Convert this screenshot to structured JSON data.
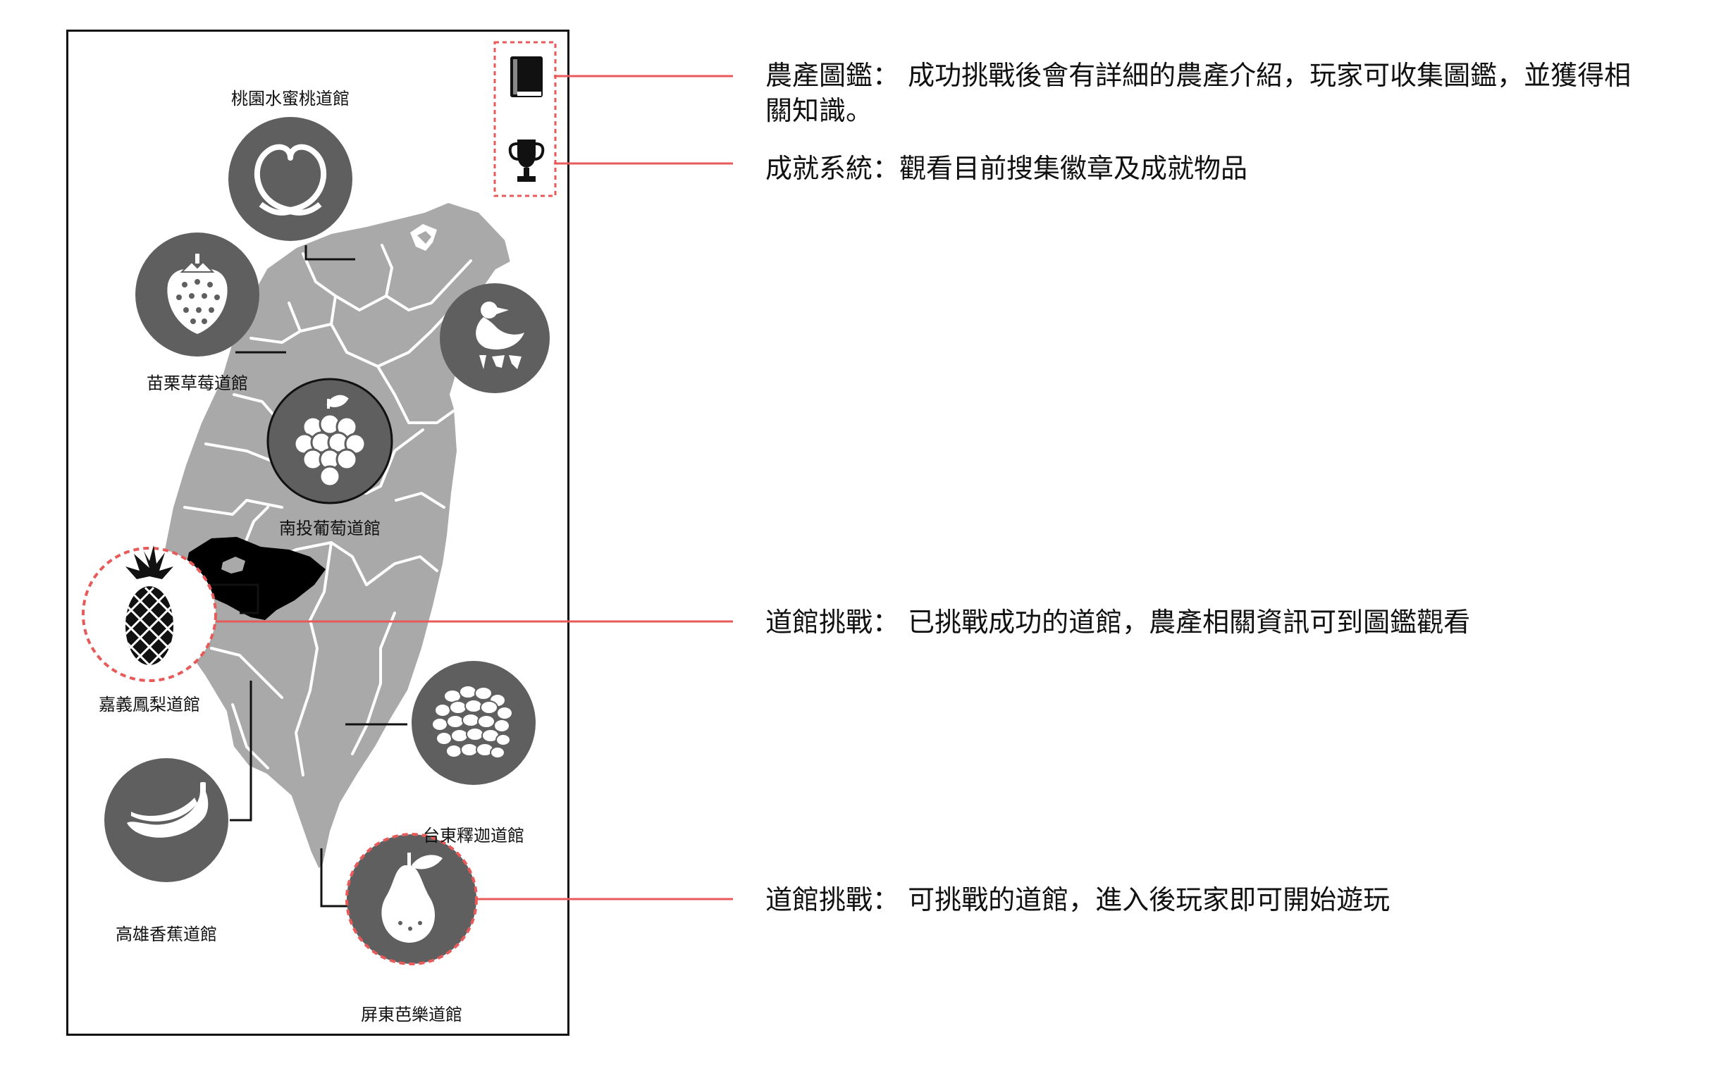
{
  "toolbar": {
    "book_icon": "book-icon",
    "trophy_icon": "trophy-icon"
  },
  "gyms": [
    {
      "label": "桃園水蜜桃道館",
      "icon": "peach-icon",
      "state": "default"
    },
    {
      "label": "苗栗草莓道館",
      "icon": "strawberry-icon",
      "state": "default"
    },
    {
      "label": "",
      "icon": "duck-icon",
      "state": "default"
    },
    {
      "label": "南投葡萄道館",
      "icon": "grape-icon",
      "state": "default"
    },
    {
      "label": "嘉義鳳梨道館",
      "icon": "pineapple-icon",
      "state": "completed"
    },
    {
      "label": "台東釋迦道館",
      "icon": "sugar-apple-icon",
      "state": "default"
    },
    {
      "label": "高雄香蕉道館",
      "icon": "banana-icon",
      "state": "default"
    },
    {
      "label": "屏東芭樂道館",
      "icon": "guava-icon",
      "state": "challengeable"
    }
  ],
  "annotations": {
    "encyclopedia": "農產圖鑑： 成功挑戰後會有詳細的農產介紹，玩家可收集圖鑑，並獲得相關知識。",
    "achievement": "成就系統：觀看目前搜集徽章及成就物品",
    "gym_done": "道館挑戰： 已挑戰成功的道館，農產相關資訊可到圖鑑觀看",
    "gym_open": "道館挑戰： 可挑戰的道館，進入後玩家即可開始遊玩"
  },
  "colors": {
    "map_fill": "#a9a9a9",
    "badge": "#5f5f5f",
    "highlight": "#e85a5a",
    "completed_region": "#000000"
  }
}
